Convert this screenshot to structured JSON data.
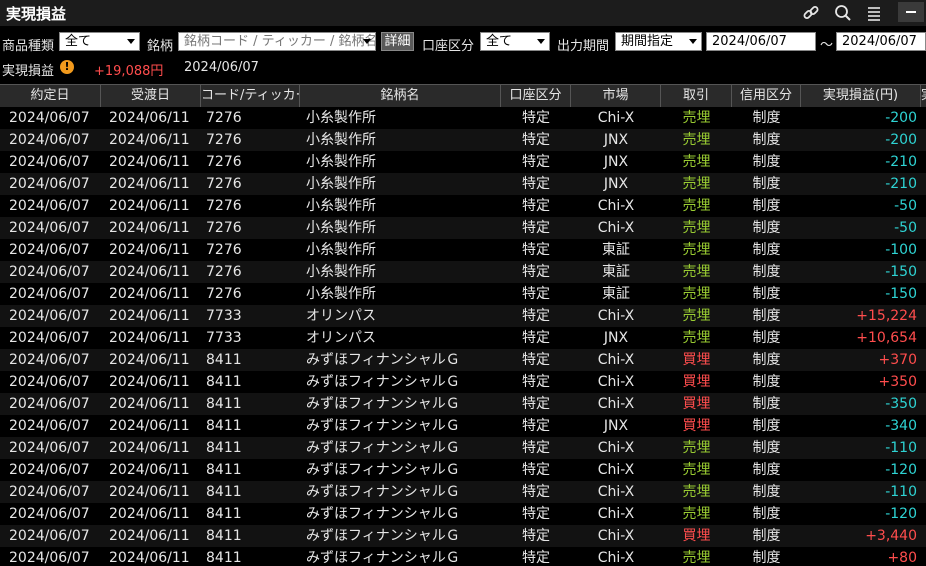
{
  "window": {
    "title": "実現損益"
  },
  "filters": {
    "product_label": "商品種類",
    "product_value": "全て",
    "symbol_label": "銘柄",
    "symbol_placeholder": "銘柄コード / ティッカー / 銘柄名",
    "detail_button": "詳細",
    "account_label": "口座区分",
    "account_value": "全て",
    "period_label": "出力期間",
    "period_value": "期間指定",
    "date_from": "2024/06/07",
    "tilde": "～",
    "date_to": "2024/06/07"
  },
  "summary": {
    "label": "実現損益",
    "warn_glyph": "!",
    "amount": "+19,088円",
    "date": "2024/06/07"
  },
  "columns": [
    "約定日",
    "受渡日",
    "コード/ティッカー",
    "銘柄名",
    "口座区分",
    "市場",
    "取引",
    "信用区分",
    "実現損益(円)",
    "実"
  ],
  "rows": [
    {
      "trade": "2024/06/07",
      "settle": "2024/06/11",
      "code": "7276",
      "name": "小糸製作所",
      "account": "特定",
      "market": "Chi-X",
      "side": "売埋",
      "side_type": "sell",
      "margin": "制度",
      "pl": "-200",
      "pl_type": "neg"
    },
    {
      "trade": "2024/06/07",
      "settle": "2024/06/11",
      "code": "7276",
      "name": "小糸製作所",
      "account": "特定",
      "market": "JNX",
      "side": "売埋",
      "side_type": "sell",
      "margin": "制度",
      "pl": "-200",
      "pl_type": "neg"
    },
    {
      "trade": "2024/06/07",
      "settle": "2024/06/11",
      "code": "7276",
      "name": "小糸製作所",
      "account": "特定",
      "market": "JNX",
      "side": "売埋",
      "side_type": "sell",
      "margin": "制度",
      "pl": "-210",
      "pl_type": "neg"
    },
    {
      "trade": "2024/06/07",
      "settle": "2024/06/11",
      "code": "7276",
      "name": "小糸製作所",
      "account": "特定",
      "market": "JNX",
      "side": "売埋",
      "side_type": "sell",
      "margin": "制度",
      "pl": "-210",
      "pl_type": "neg"
    },
    {
      "trade": "2024/06/07",
      "settle": "2024/06/11",
      "code": "7276",
      "name": "小糸製作所",
      "account": "特定",
      "market": "Chi-X",
      "side": "売埋",
      "side_type": "sell",
      "margin": "制度",
      "pl": "-50",
      "pl_type": "neg"
    },
    {
      "trade": "2024/06/07",
      "settle": "2024/06/11",
      "code": "7276",
      "name": "小糸製作所",
      "account": "特定",
      "market": "Chi-X",
      "side": "売埋",
      "side_type": "sell",
      "margin": "制度",
      "pl": "-50",
      "pl_type": "neg"
    },
    {
      "trade": "2024/06/07",
      "settle": "2024/06/11",
      "code": "7276",
      "name": "小糸製作所",
      "account": "特定",
      "market": "東証",
      "side": "売埋",
      "side_type": "sell",
      "margin": "制度",
      "pl": "-100",
      "pl_type": "neg"
    },
    {
      "trade": "2024/06/07",
      "settle": "2024/06/11",
      "code": "7276",
      "name": "小糸製作所",
      "account": "特定",
      "market": "東証",
      "side": "売埋",
      "side_type": "sell",
      "margin": "制度",
      "pl": "-150",
      "pl_type": "neg"
    },
    {
      "trade": "2024/06/07",
      "settle": "2024/06/11",
      "code": "7276",
      "name": "小糸製作所",
      "account": "特定",
      "market": "東証",
      "side": "売埋",
      "side_type": "sell",
      "margin": "制度",
      "pl": "-150",
      "pl_type": "neg"
    },
    {
      "trade": "2024/06/07",
      "settle": "2024/06/11",
      "code": "7733",
      "name": "オリンパス",
      "account": "特定",
      "market": "Chi-X",
      "side": "売埋",
      "side_type": "sell",
      "margin": "制度",
      "pl": "+15,224",
      "pl_type": "pos"
    },
    {
      "trade": "2024/06/07",
      "settle": "2024/06/11",
      "code": "7733",
      "name": "オリンパス",
      "account": "特定",
      "market": "JNX",
      "side": "売埋",
      "side_type": "sell",
      "margin": "制度",
      "pl": "+10,654",
      "pl_type": "pos"
    },
    {
      "trade": "2024/06/07",
      "settle": "2024/06/11",
      "code": "8411",
      "name": "みずほフィナンシャルＧ",
      "account": "特定",
      "market": "Chi-X",
      "side": "買埋",
      "side_type": "buy",
      "margin": "制度",
      "pl": "+370",
      "pl_type": "pos"
    },
    {
      "trade": "2024/06/07",
      "settle": "2024/06/11",
      "code": "8411",
      "name": "みずほフィナンシャルＧ",
      "account": "特定",
      "market": "Chi-X",
      "side": "買埋",
      "side_type": "buy",
      "margin": "制度",
      "pl": "+350",
      "pl_type": "pos"
    },
    {
      "trade": "2024/06/07",
      "settle": "2024/06/11",
      "code": "8411",
      "name": "みずほフィナンシャルＧ",
      "account": "特定",
      "market": "Chi-X",
      "side": "買埋",
      "side_type": "buy",
      "margin": "制度",
      "pl": "-350",
      "pl_type": "neg"
    },
    {
      "trade": "2024/06/07",
      "settle": "2024/06/11",
      "code": "8411",
      "name": "みずほフィナンシャルＧ",
      "account": "特定",
      "market": "JNX",
      "side": "買埋",
      "side_type": "buy",
      "margin": "制度",
      "pl": "-340",
      "pl_type": "neg"
    },
    {
      "trade": "2024/06/07",
      "settle": "2024/06/11",
      "code": "8411",
      "name": "みずほフィナンシャルＧ",
      "account": "特定",
      "market": "Chi-X",
      "side": "売埋",
      "side_type": "sell",
      "margin": "制度",
      "pl": "-110",
      "pl_type": "neg"
    },
    {
      "trade": "2024/06/07",
      "settle": "2024/06/11",
      "code": "8411",
      "name": "みずほフィナンシャルＧ",
      "account": "特定",
      "market": "Chi-X",
      "side": "売埋",
      "side_type": "sell",
      "margin": "制度",
      "pl": "-120",
      "pl_type": "neg"
    },
    {
      "trade": "2024/06/07",
      "settle": "2024/06/11",
      "code": "8411",
      "name": "みずほフィナンシャルＧ",
      "account": "特定",
      "market": "Chi-X",
      "side": "売埋",
      "side_type": "sell",
      "margin": "制度",
      "pl": "-110",
      "pl_type": "neg"
    },
    {
      "trade": "2024/06/07",
      "settle": "2024/06/11",
      "code": "8411",
      "name": "みずほフィナンシャルＧ",
      "account": "特定",
      "market": "Chi-X",
      "side": "売埋",
      "side_type": "sell",
      "margin": "制度",
      "pl": "-120",
      "pl_type": "neg"
    },
    {
      "trade": "2024/06/07",
      "settle": "2024/06/11",
      "code": "8411",
      "name": "みずほフィナンシャルＧ",
      "account": "特定",
      "market": "Chi-X",
      "side": "買埋",
      "side_type": "buy",
      "margin": "制度",
      "pl": "+3,440",
      "pl_type": "pos"
    },
    {
      "trade": "2024/06/07",
      "settle": "2024/06/11",
      "code": "8411",
      "name": "みずほフィナンシャルＧ",
      "account": "特定",
      "market": "Chi-X",
      "side": "売埋",
      "side_type": "sell",
      "margin": "制度",
      "pl": "+80",
      "pl_type": "pos"
    }
  ],
  "colors": {
    "sell": "#9acd32",
    "buy": "#ff4d4d",
    "loss": "#2ed3d3",
    "gain": "#ff4d4d",
    "warning": "#f29a1d"
  },
  "icons": {
    "link": "link-icon",
    "search": "search-icon",
    "menu": "menu-icon",
    "minimize": "minimize-icon",
    "warning": "warning-icon"
  }
}
